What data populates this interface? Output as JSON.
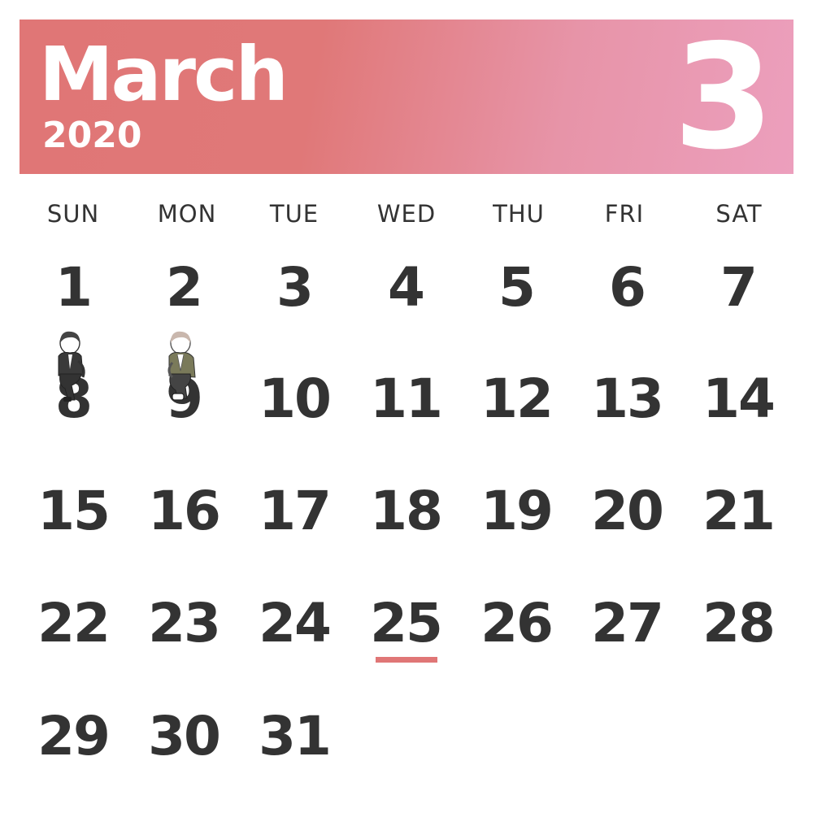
{
  "header": {
    "month_name": "March",
    "year": "2020",
    "month_number": "3",
    "accent_color_start": "#e07676",
    "accent_color_end": "#ec9fbd"
  },
  "weekdays": [
    "SUN",
    "MON",
    "TUE",
    "WED",
    "THU",
    "FRI",
    "SAT"
  ],
  "weeks": [
    [
      "1",
      "2",
      "3",
      "4",
      "5",
      "6",
      "7"
    ],
    [
      "8",
      "9",
      "10",
      "11",
      "12",
      "13",
      "14"
    ],
    [
      "15",
      "16",
      "17",
      "18",
      "19",
      "20",
      "21"
    ],
    [
      "22",
      "23",
      "24",
      "25",
      "26",
      "27",
      "28"
    ],
    [
      "29",
      "30",
      "31",
      "",
      "",
      "",
      ""
    ]
  ],
  "highlighted_day": "25",
  "highlight_color": "#e07676",
  "illustrations": [
    "sitting-boy-dark-hair-illustration",
    "sitting-boy-light-hair-illustration"
  ]
}
